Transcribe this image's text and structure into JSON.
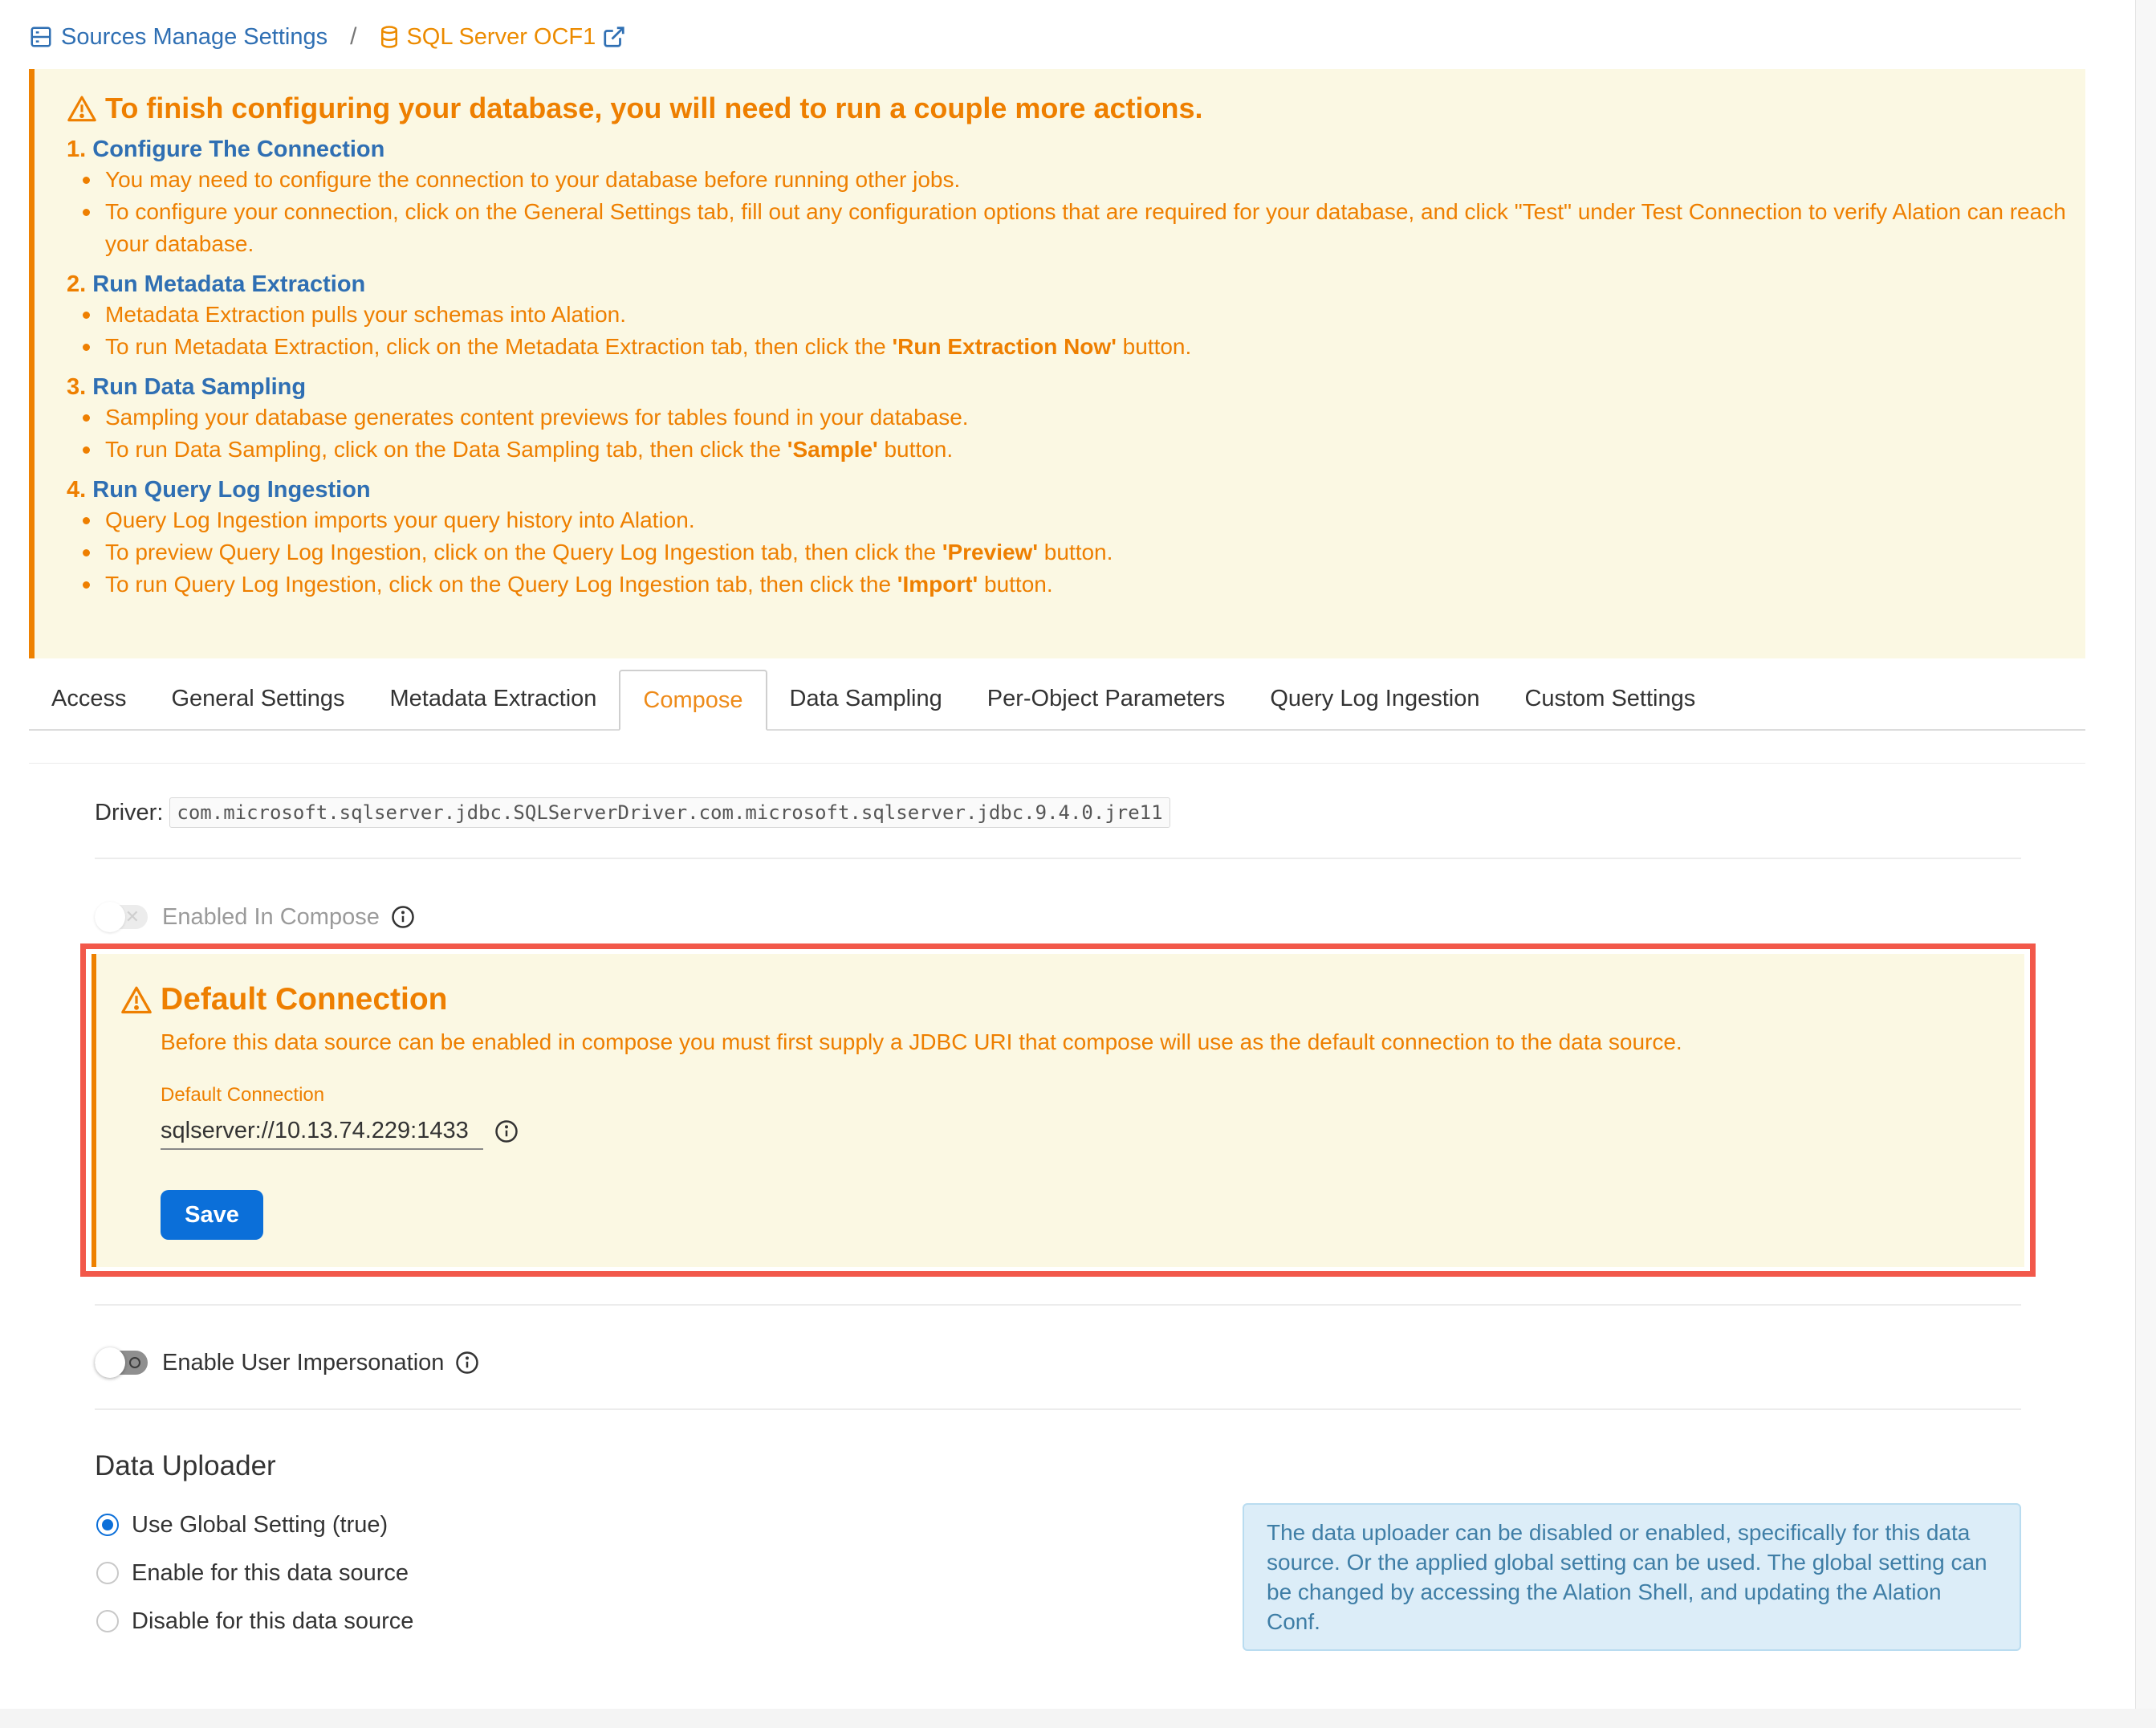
{
  "breadcrumb": {
    "parent": "Sources Manage Settings",
    "separator": "/",
    "current": "SQL Server OCF1"
  },
  "banner": {
    "title": "To finish configuring your database, you will need to run a couple more actions.",
    "steps": [
      {
        "number": "1.",
        "title": "Configure The Connection",
        "bullets": [
          {
            "text": "You may need to configure the connection to your database before running other jobs."
          },
          {
            "text": "To configure your connection, click on the General Settings tab, fill out any configuration options that are required for your database, and click \"Test\" under Test Connection to verify Alation can reach your database."
          }
        ]
      },
      {
        "number": "2.",
        "title": "Run Metadata Extraction",
        "bullets": [
          {
            "text": "Metadata Extraction pulls your schemas into Alation."
          },
          {
            "pre": "To run Metadata Extraction, click on the Metadata Extraction tab, then click the ",
            "bold": "'Run Extraction Now'",
            "post": " button."
          }
        ]
      },
      {
        "number": "3.",
        "title": "Run Data Sampling",
        "bullets": [
          {
            "text": "Sampling your database generates content previews for tables found in your database."
          },
          {
            "pre": "To run Data Sampling, click on the Data Sampling tab, then click the ",
            "bold": "'Sample'",
            "post": " button."
          }
        ]
      },
      {
        "number": "4.",
        "title": "Run Query Log Ingestion",
        "bullets": [
          {
            "text": "Query Log Ingestion imports your query history into Alation."
          },
          {
            "pre": "To preview Query Log Ingestion, click on the Query Log Ingestion tab, then click the ",
            "bold": "'Preview'",
            "post": " button."
          },
          {
            "pre": "To run Query Log Ingestion, click on the Query Log Ingestion tab, then click the ",
            "bold": "'Import'",
            "post": " button."
          }
        ]
      }
    ]
  },
  "tabs": [
    {
      "label": "Access",
      "active": false
    },
    {
      "label": "General Settings",
      "active": false
    },
    {
      "label": "Metadata Extraction",
      "active": false
    },
    {
      "label": "Compose",
      "active": true
    },
    {
      "label": "Data Sampling",
      "active": false
    },
    {
      "label": "Per-Object Parameters",
      "active": false
    },
    {
      "label": "Query Log Ingestion",
      "active": false
    },
    {
      "label": "Custom Settings",
      "active": false
    }
  ],
  "compose": {
    "driver_label": "Driver:",
    "driver_value": "com.microsoft.sqlserver.jdbc.SQLServerDriver.com.microsoft.sqlserver.jdbc.9.4.0.jre11",
    "enabled_label": "Enabled In Compose",
    "default_connection": {
      "title": "Default Connection",
      "description": "Before this data source can be enabled in compose you must first supply a JDBC URI that compose will use as the default connection to the data source.",
      "field_label": "Default Connection",
      "field_value": "sqlserver://10.13.74.229:1433",
      "save_label": "Save"
    },
    "impersonation_label": "Enable User Impersonation"
  },
  "data_uploader": {
    "title": "Data Uploader",
    "options": [
      {
        "label": "Use Global Setting (true)",
        "checked": true
      },
      {
        "label": "Enable for this data source",
        "checked": false
      },
      {
        "label": "Disable for this data source",
        "checked": false
      }
    ],
    "info": "The data uploader can be disabled or enabled, specifically for this data source. Or the applied global setting can be used. The global setting can be changed by accessing the Alation Shell, and updating the Alation Conf."
  },
  "colors": {
    "accent_orange": "#ee7f00",
    "link_blue": "#2f6fb3",
    "primary_button": "#0b6fd9",
    "highlight_red": "#f2584a",
    "banner_bg": "#fbf8e3"
  },
  "icons": {
    "breadcrumb_parent": "server-icon",
    "breadcrumb_current": "database-icon",
    "external": "external-link-icon",
    "warning": "warning-triangle-icon",
    "info": "info-circle-icon"
  }
}
